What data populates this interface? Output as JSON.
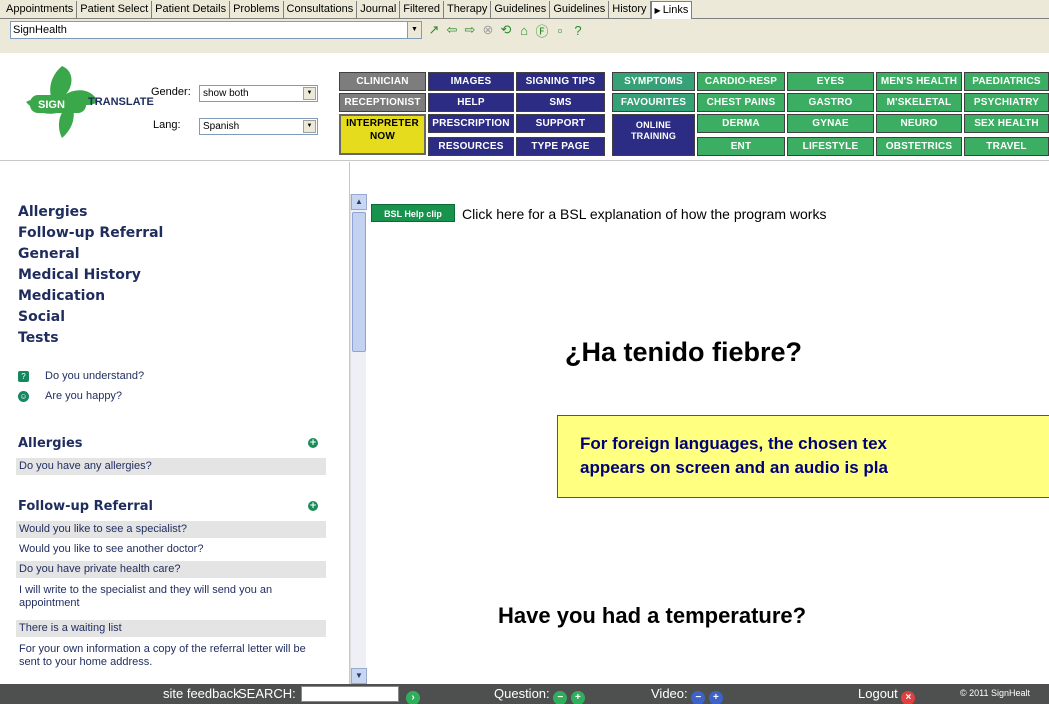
{
  "tabs": [
    {
      "label": "Appointments"
    },
    {
      "label": "Patient Select"
    },
    {
      "label": "Patient Details"
    },
    {
      "label": "Problems"
    },
    {
      "label": "Consultations"
    },
    {
      "label": "Journal"
    },
    {
      "label": "Filtered"
    },
    {
      "label": "Therapy"
    },
    {
      "label": "Guidelines"
    },
    {
      "label": "Guidelines"
    },
    {
      "label": "History"
    },
    {
      "label": "Links"
    }
  ],
  "address": {
    "value": "SignHealth"
  },
  "nav_icons": [
    "go-icon",
    "back-icon",
    "forward-icon",
    "stop-icon",
    "refresh-icon",
    "home-icon",
    "favourites-icon",
    "popout-icon",
    "help-icon"
  ],
  "logo": {
    "sign": "SIGN",
    "translate": "TRANSLATE"
  },
  "filters": {
    "gender_label": "Gender:",
    "gender_value": "show both",
    "lang_label": "Lang:",
    "lang_value": "Spanish"
  },
  "nav_buttons": {
    "clinician": "CLINICIAN",
    "receptionist": "RECEPTIONIST",
    "interpreter_1": "INTERPRETER",
    "interpreter_2": "NOW",
    "images": "IMAGES",
    "help": "HELP",
    "prescription": "PRESCRIPTION",
    "resources": "RESOURCES",
    "signing_tips": "SIGNING TIPS",
    "sms": "SMS",
    "support": "SUPPORT",
    "type_page": "TYPE PAGE",
    "symptoms": "SYMPTOMS",
    "favourites": "FAVOURITES",
    "online_1": "ONLINE",
    "online_2": "TRAINING",
    "cardio": "CARDIO-RESP",
    "chest": "CHEST PAINS",
    "derma": "DERMA",
    "ent": "ENT",
    "eyes": "EYES",
    "gastro": "GASTRO",
    "gynae": "GYNAE",
    "lifestyle": "LIFESTYLE",
    "mens": "MEN'S HEALTH",
    "mskeletal": "M'SKELETAL",
    "neuro": "NEURO",
    "obstetrics": "OBSTETRICS",
    "paediatrics": "PAEDIATRICS",
    "psychiatry": "PSYCHIATRY",
    "sexhealth": "SEX HEALTH",
    "travel": "TRAVEL"
  },
  "colors": {
    "nav_gray": "#7d7d7d",
    "nav_blue": "#2c2c84",
    "nav_green": "#3cae63",
    "interpreter_yellow": "#e6dc1e",
    "link_text": "#1f2c5e",
    "note_bg": "#ffff80"
  },
  "categories": [
    "Allergies",
    "Follow-up Referral",
    "General",
    "Medical History",
    "Medication",
    "Social",
    "Tests"
  ],
  "quick": {
    "understand": "Do you understand?",
    "happy": "Are you happy?"
  },
  "sections": {
    "allergies": {
      "title": "Allergies",
      "phrases": [
        "Do you have any allergies?"
      ]
    },
    "followup": {
      "title": "Follow-up Referral",
      "phrases": [
        "Would you like to see a specialist?",
        "Would you like to see another doctor?",
        "Do you have private health care?",
        "I will write to the specialist and they will send you an appointment",
        "There is a waiting list",
        "For your own information a copy of the referral letter will be sent to your home address."
      ]
    }
  },
  "main": {
    "bsl_button": "BSL Help clip",
    "bsl_text": "Click here for a BSL explanation of how the program works",
    "foreign_text": "¿Ha tenido fiebre?",
    "note_line1": "For foreign languages, the chosen tex",
    "note_line2": "appears on screen and an audio is pla",
    "english_text": "Have you had a temperature?"
  },
  "footer": {
    "feedback": "site feedback",
    "search_label": "SEARCH:",
    "question_label": "Question:",
    "video_label": "Video:",
    "logout": "Logout",
    "copyright": "© 2011 SignHealt"
  }
}
